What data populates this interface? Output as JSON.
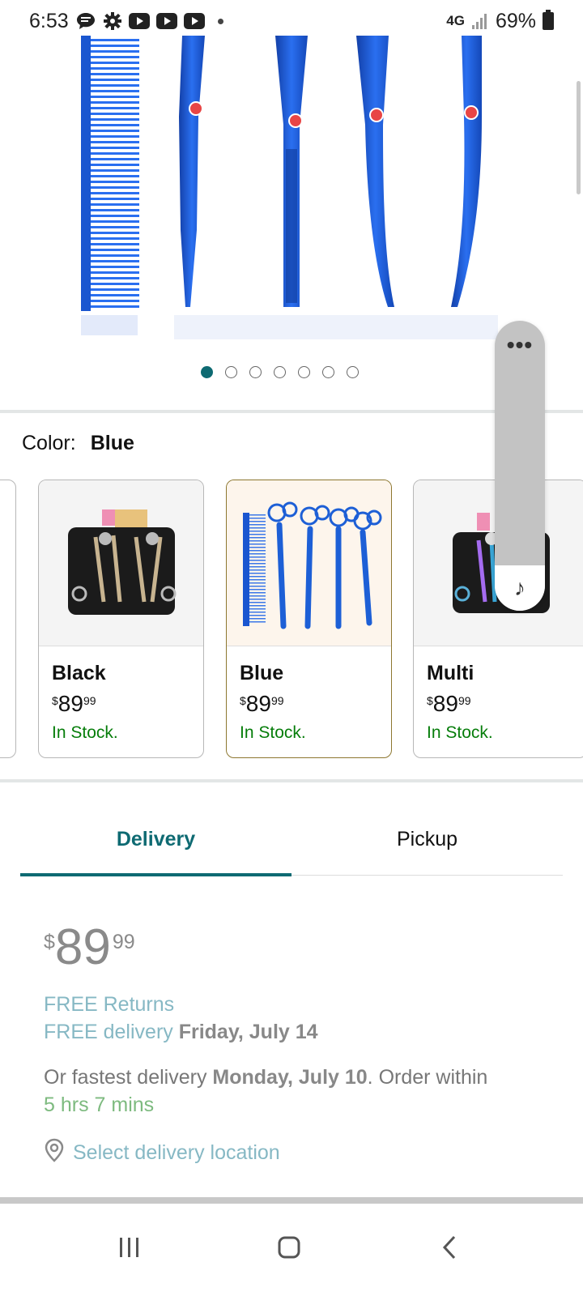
{
  "status_bar": {
    "time": "6:53",
    "network": "4G",
    "battery": "69%",
    "icons": [
      "chat-icon",
      "gear-icon",
      "youtube-icon",
      "youtube-icon",
      "youtube-icon",
      "dot-icon",
      "signal-icon",
      "battery-icon"
    ]
  },
  "carousel": {
    "total": 7,
    "active_index": 0
  },
  "color": {
    "label": "Color:",
    "value": "Blue"
  },
  "swatches": [
    {
      "name": "Black",
      "price_symbol": "$",
      "price_whole": "89",
      "price_fraction": "99",
      "stock": "In Stock.",
      "selected": false
    },
    {
      "name": "Blue",
      "price_symbol": "$",
      "price_whole": "89",
      "price_fraction": "99",
      "stock": "In Stock.",
      "selected": true
    },
    {
      "name": "Multi",
      "price_symbol": "$",
      "price_whole": "89",
      "price_fraction": "99",
      "stock": "In Stock.",
      "selected": false
    }
  ],
  "floating_widget": {
    "menu_icon": "more-dots-icon",
    "media_icon": "music-note-icon"
  },
  "tabs": [
    {
      "label": "Delivery",
      "active": true
    },
    {
      "label": "Pickup",
      "active": false
    }
  ],
  "price": {
    "symbol": "$",
    "whole": "89",
    "fraction": "99"
  },
  "delivery": {
    "returns": "FREE Returns",
    "free_delivery_label": "FREE delivery",
    "free_delivery_date": "Friday, July 14",
    "fastest_prefix": "Or fastest delivery",
    "fastest_date": "Monday, July 10",
    "order_within_label": ". Order within",
    "countdown": "5 hrs 7 mins",
    "location_link": "Select delivery location"
  },
  "colors": {
    "accent": "#0e6a72",
    "in_stock": "#067d0a",
    "link": "#86b8c4",
    "product_blue": "#1d5fd6"
  },
  "nav": {
    "recent_icon": "recent-apps-icon",
    "home_icon": "home-icon",
    "back_icon": "back-icon"
  }
}
